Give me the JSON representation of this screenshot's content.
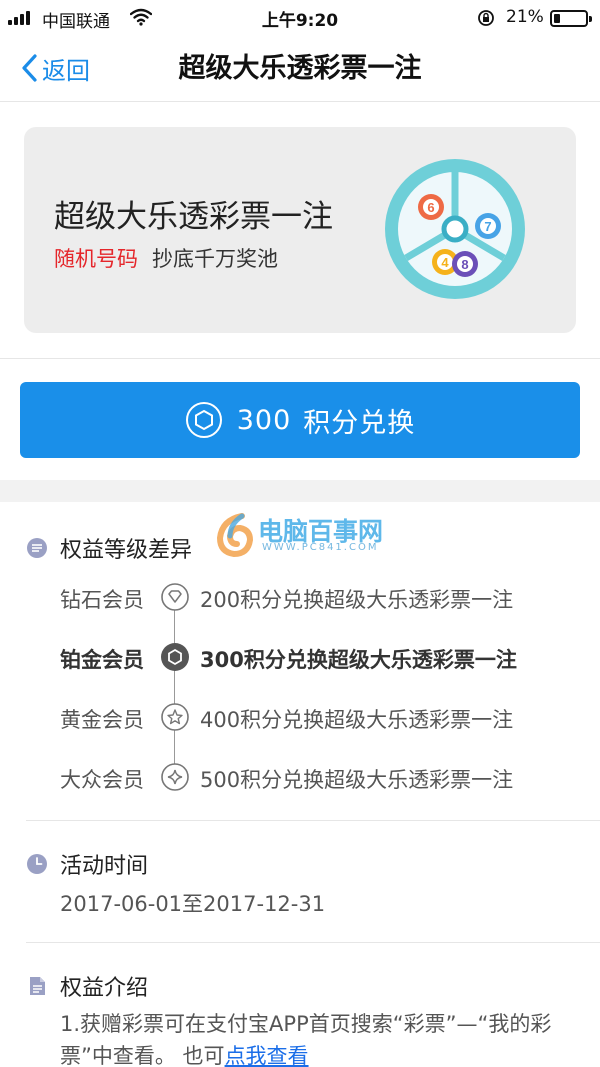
{
  "status_bar": {
    "carrier": "中国联通",
    "time": "上午9:20",
    "battery_percent": "21%",
    "battery_level": 0.21
  },
  "nav": {
    "back_label": "返回",
    "title": "超级大乐透彩票一注"
  },
  "product": {
    "title": "超级大乐透彩票一注",
    "tag": "随机号码",
    "subtitle": "抄底千万奖池",
    "ball_numbers": [
      "6",
      "7",
      "4",
      "8"
    ]
  },
  "redeem": {
    "points": "300",
    "label": "积分兑换"
  },
  "watermark": {
    "text": "电脑百事网",
    "url": "WWW.PC841.COM"
  },
  "benefits": {
    "heading": "权益等级差异",
    "levels": [
      {
        "name": "钻石会员",
        "desc": "200积分兑换超级大乐透彩票一注",
        "icon": "diamond-icon"
      },
      {
        "name": "铂金会员",
        "desc": "300积分兑换超级大乐透彩票一注",
        "icon": "hexagon-icon"
      },
      {
        "name": "黄金会员",
        "desc": "400积分兑换超级大乐透彩票一注",
        "icon": "star-icon"
      },
      {
        "name": "大众会员",
        "desc": "500积分兑换超级大乐透彩票一注",
        "icon": "sparkle-icon"
      }
    ]
  },
  "activity": {
    "heading": "活动时间",
    "dates": "2017-06-01至2017-12-31"
  },
  "intro": {
    "heading": "权益介绍",
    "text_line1": "1.获赠彩票可在支付宝APP首页搜索“彩票”—“我的彩",
    "text_line2": "票”中查看。 也可",
    "link": "点我查看"
  },
  "colors": {
    "accent": "#1a8fe9",
    "link": "#1b6ee8",
    "tag_red": "#e5262b"
  }
}
